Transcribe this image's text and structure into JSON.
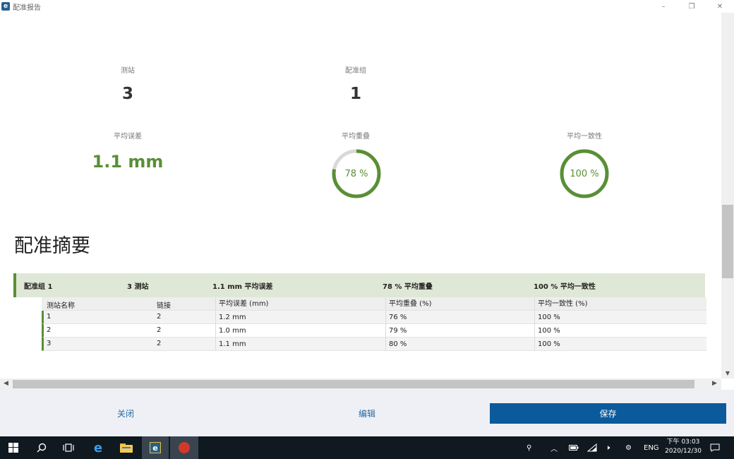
{
  "window": {
    "title": "配准报告",
    "minimize": "–",
    "maximize": "❐",
    "close": "✕"
  },
  "stats": {
    "stations": {
      "label": "测站",
      "value": "3"
    },
    "groups": {
      "label": "配准组",
      "value": "1"
    },
    "avg_error": {
      "label": "平均误差",
      "value": "1.1 mm"
    },
    "avg_overlap": {
      "label": "平均重叠",
      "value": "78 %",
      "fraction": 0.78
    },
    "avg_consistency": {
      "label": "平均一致性",
      "value": "100 %",
      "fraction": 1.0
    }
  },
  "summary": {
    "title": "配准摘要",
    "group": {
      "name": "配准组 1",
      "stations": "3 测站",
      "error": "1.1 mm 平均误差",
      "overlap": "78 % 平均重叠",
      "consistency": "100 % 平均一致性"
    },
    "table": {
      "headers": [
        "测站名称",
        "链接",
        "平均误差 (mm)",
        "平均重叠 (%)",
        "平均一致性 (%)"
      ],
      "rows": [
        [
          "1",
          "2",
          "1.2 mm",
          "76 %",
          "100 %"
        ],
        [
          "2",
          "2",
          "1.0 mm",
          "79 %",
          "100 %"
        ],
        [
          "3",
          "2",
          "1.1 mm",
          "80 %",
          "100 %"
        ]
      ]
    }
  },
  "footer": {
    "close": "关闭",
    "edit": "编辑",
    "save": "保存"
  },
  "taskbar": {
    "language": "ENG",
    "time": "下午 03:03",
    "date": "2020/12/30",
    "icons": [
      "windows-start-icon",
      "search-icon",
      "task-view-icon",
      "edge-icon",
      "file-explorer-icon",
      "cyclone-app-icon",
      "scan-app-icon"
    ]
  },
  "colors": {
    "accent_green": "#5a8f35",
    "primary_blue": "#0a5a9c",
    "group_bg": "#dfe8d6"
  }
}
